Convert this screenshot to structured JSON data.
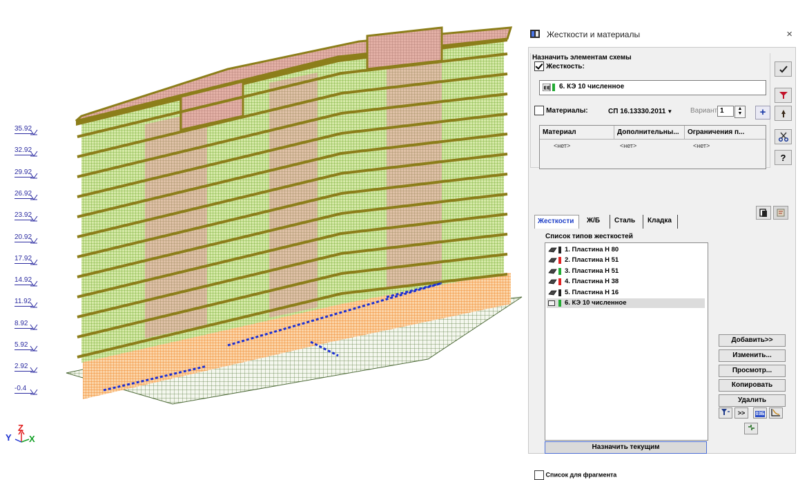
{
  "view": {
    "levels": [
      "35.92",
      "32.92",
      "29.92",
      "26.92",
      "23.92",
      "20.92",
      "17.92",
      "14.92",
      "11.92",
      "8.92",
      "5.92",
      "2.92",
      "-0.4"
    ],
    "axes": {
      "y": "Y",
      "z": "Z",
      "x": "X"
    },
    "colors": {
      "slab": "#8c7e1a",
      "mesh": "#7fb52e",
      "wall": "#e8a9a0",
      "base": "#f59a3c",
      "beam": "#1b2fd4",
      "ground": "#4f6b3a"
    }
  },
  "dialog": {
    "title": "Жесткости и материалы",
    "close": "×",
    "assign_group": "Назначить элементам схемы",
    "stiffness_label": "Жесткость:",
    "stiffness_current": "6. КЭ 10 численное",
    "materials_label": "Материалы:",
    "materials_standard": "СП 16.13330.2011",
    "variant_label": "Вариант",
    "variant_value": "1",
    "table_headers": [
      "Материал",
      "Дополнительны...",
      "Ограничения п..."
    ],
    "table_cells": [
      "<нет>",
      "<нет>",
      "<нет>"
    ],
    "tabs": [
      "Жесткости",
      "Ж/Б",
      "Сталь",
      "Кладка"
    ],
    "type_list_label": "Список типов жесткостей",
    "types": [
      {
        "label": "1. Пластина  H 80",
        "color": "#222222"
      },
      {
        "label": "2. Пластина  H 51",
        "color": "#e02222"
      },
      {
        "label": "3. Пластина  H 51",
        "color": "#22aa33"
      },
      {
        "label": "4. Пластина  H 38",
        "color": "#e02222"
      },
      {
        "label": "5. Пластина  H 16",
        "color": "#222222"
      },
      {
        "label": "6. КЭ 10 численное",
        "color": "#22aa33"
      }
    ],
    "actions": [
      "Добавить>>",
      "Изменить...",
      "Просмотр...",
      "Копировать",
      "Удалить"
    ],
    "small_buttons": {
      "expand": ">>",
      "tag": "03Б"
    },
    "assign_current": "Назначить текущим",
    "fragment_label": "Список для фрагмента"
  }
}
